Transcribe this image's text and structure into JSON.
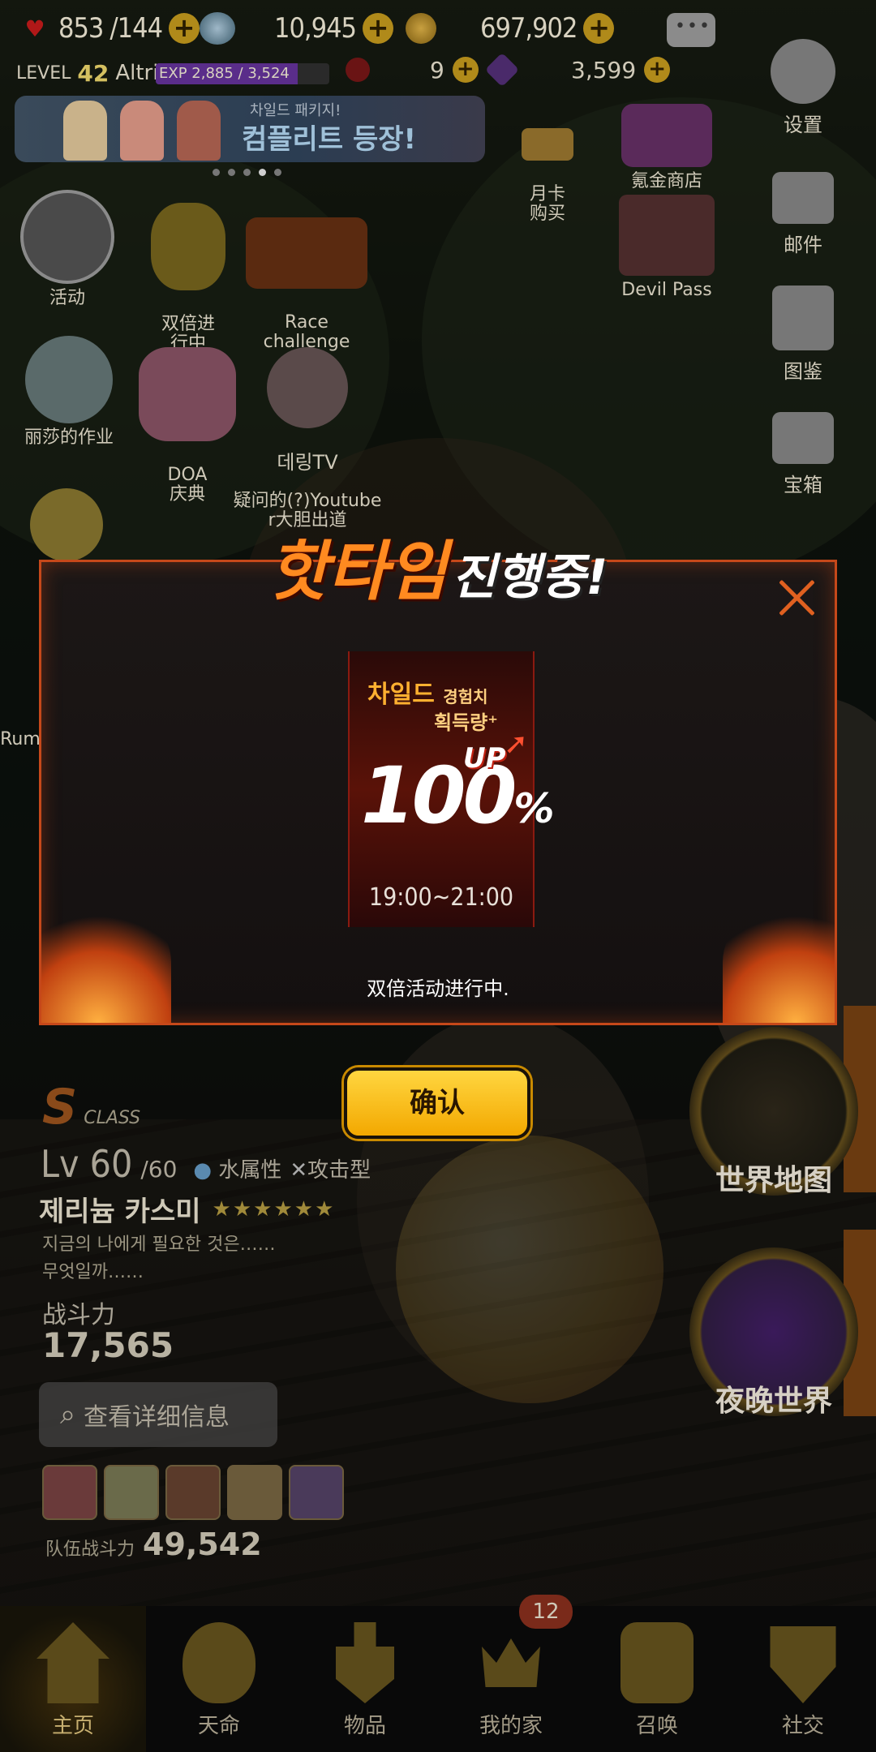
{
  "topbar": {
    "hearts": "853",
    "hearts_max": "/144",
    "gems": "10,945",
    "gold": "697,902"
  },
  "level": {
    "label": "LEVEL",
    "num": "42",
    "name": "Altriar",
    "exp": "EXP 2,885 / 3,524",
    "exp_progress": 0.82,
    "sub1": "9",
    "sub2": "3,599"
  },
  "banner": {
    "sub": "차일드 패키지!",
    "title": "컴플리트 등장!"
  },
  "shop": {
    "monthly": "月卡\n购买",
    "store_label": "氪金商店",
    "devilpass": "Devil Pass",
    "settings": "设置",
    "mail": "邮件",
    "collection": "图鉴",
    "chest": "宝箱"
  },
  "features": {
    "event": "活动",
    "double": "双倍进\n行中",
    "race": "Race\nchallenge",
    "lisa": "丽莎的作业",
    "doa": "DOA\n庆典",
    "tv_tag": "데링TV",
    "youtube": "疑问的(?)Youtube\nr大胆出道",
    "rumi": "Rumi"
  },
  "character": {
    "class_big": "S",
    "class_small": "CLASS",
    "lv": "Lv 60",
    "lv_max": "/60",
    "element": "水属性",
    "type": "攻击型",
    "name": "제리늄 카스미",
    "stars": "★★★★★★",
    "desc": "지금의 나에게 필요한 것은……\n무엇일까……",
    "power_label": "战斗力",
    "power": "17,565",
    "detail_button": "查看详细信息",
    "team_label": "队伍战斗力",
    "team_power": "49,542"
  },
  "right_buttons": {
    "world_map": "世界地图",
    "night_world": "夜晚世界"
  },
  "modal": {
    "title_hot": "핫타임",
    "title_rest": "진행중!",
    "card_line1": "차일드",
    "card_line1_small": "경험치",
    "card_line2": "획득량⁺",
    "percent": "100",
    "percent_sign": "%",
    "up": "UP",
    "time": "19:00~21:00",
    "message": "双倍活动进行中.",
    "confirm": "确认"
  },
  "nav": {
    "home": "主页",
    "fate": "天命",
    "items": "物品",
    "myhome": "我的家",
    "summon": "召唤",
    "social": "社交",
    "badge": "12"
  },
  "colors": {
    "accent": "#f3a800",
    "modal_border": "#c6481a",
    "hot_text": "#ff8a20"
  }
}
